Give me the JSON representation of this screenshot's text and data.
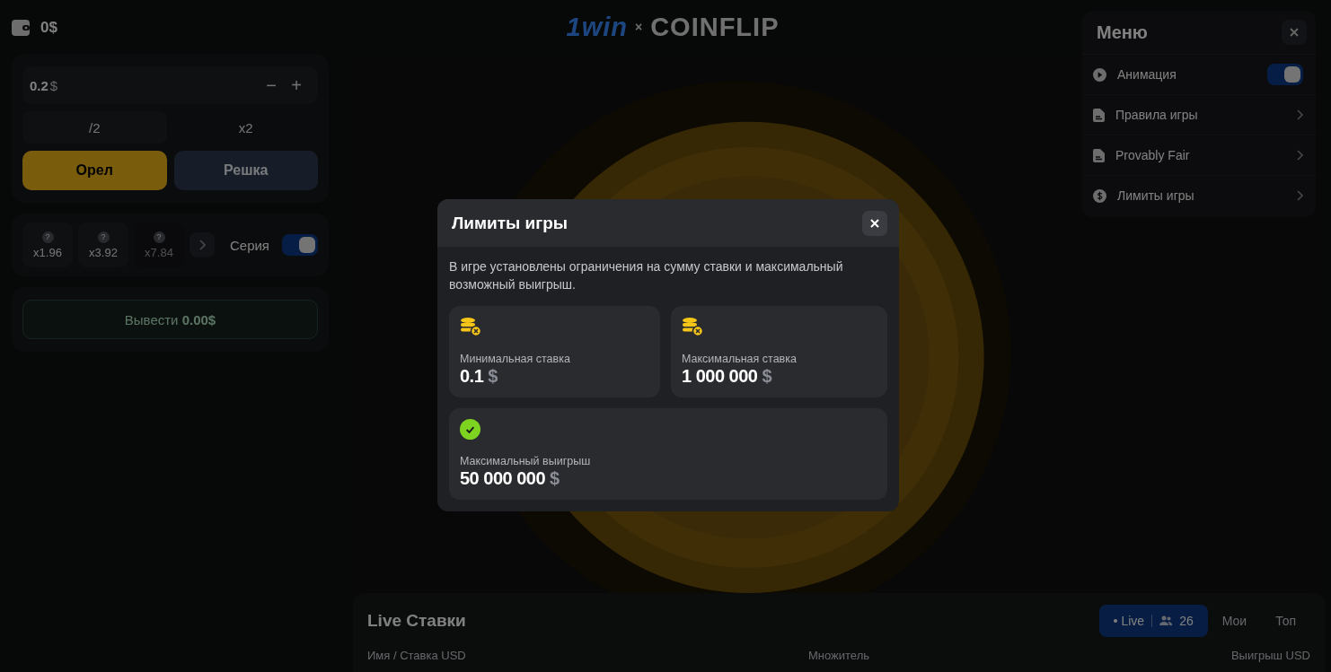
{
  "header": {
    "balance": "0$",
    "logo_brand": "1win",
    "logo_separator": "×",
    "logo_game": "COINFLIP"
  },
  "bet_panel": {
    "amount": "0.2",
    "currency": "$",
    "decrement": "−",
    "increment": "+",
    "quick_buttons": [
      "/2",
      "x2"
    ],
    "choices": [
      {
        "label": "Орел",
        "kind": "heads"
      },
      {
        "label": "Решка",
        "kind": "tails"
      }
    ]
  },
  "series": {
    "steps": [
      {
        "mark": "?",
        "multiplier": "x1.96",
        "disabled": false
      },
      {
        "mark": "?",
        "multiplier": "x3.92",
        "disabled": false
      },
      {
        "mark": "?",
        "multiplier": "x7.84",
        "disabled": true
      }
    ],
    "label": "Серия",
    "on": true
  },
  "cashout": {
    "label": "Вывести",
    "amount": "0.00$"
  },
  "menu": {
    "title": "Меню",
    "items": [
      {
        "label": "Анимация",
        "kind": "toggle",
        "on": true
      },
      {
        "label": "Правила игры",
        "kind": "link"
      },
      {
        "label": "Provably Fair",
        "kind": "link"
      },
      {
        "label": "Лимиты игры",
        "kind": "link"
      }
    ]
  },
  "live_bets": {
    "title": "Live Ставки",
    "tabs": [
      {
        "label": "Live",
        "count": "26",
        "selected": true
      },
      {
        "label": "Мои",
        "selected": false
      },
      {
        "label": "Топ",
        "selected": false
      }
    ],
    "columns": [
      "Имя / Ставка USD",
      "Множитель",
      "Выигрыш USD"
    ]
  },
  "dialog": {
    "title": "Лимиты игры",
    "description": "В игре установлены ограничения на сумму ставки и максимальный возможный выигрыш.",
    "limits": [
      {
        "kind": "coins",
        "label": "Минимальная ставка",
        "value": "0.1",
        "currency": "$"
      },
      {
        "kind": "coins",
        "label": "Максимальная ставка",
        "value": "1 000 000",
        "currency": "$"
      },
      {
        "kind": "check",
        "label": "Максимальный выигрыш",
        "value": "50 000 000",
        "currency": "$"
      }
    ]
  }
}
